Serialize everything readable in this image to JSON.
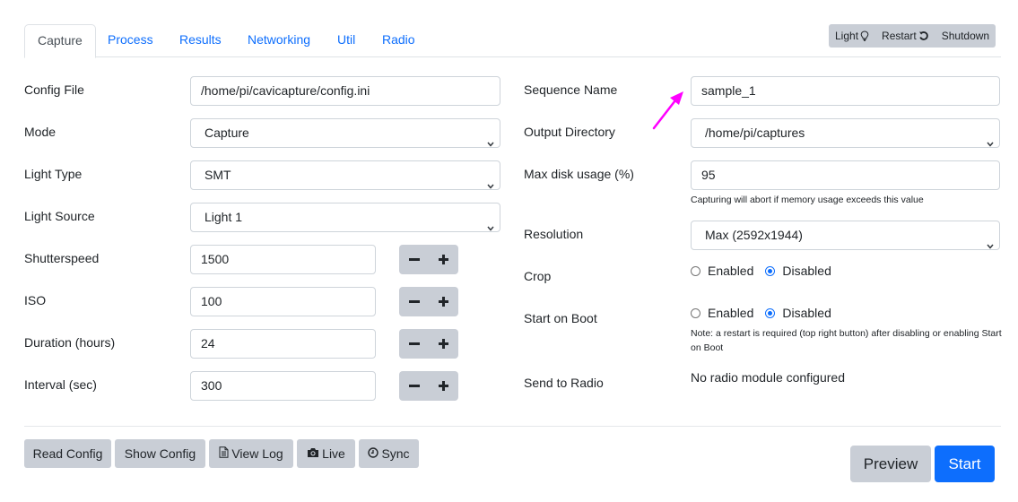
{
  "tabs": [
    {
      "label": "Capture",
      "active": true
    },
    {
      "label": "Process",
      "active": false
    },
    {
      "label": "Results",
      "active": false
    },
    {
      "label": "Networking",
      "active": false
    },
    {
      "label": "Util",
      "active": false
    },
    {
      "label": "Radio",
      "active": false
    }
  ],
  "top_buttons": {
    "light": {
      "label": "Light",
      "icon": "lightbulb-icon"
    },
    "restart": {
      "label": "Restart",
      "icon": "restart-icon"
    },
    "shutdown": {
      "label": "Shutdown"
    }
  },
  "left_form": {
    "config_file": {
      "label": "Config File",
      "value": "/home/pi/cavicapture/config.ini"
    },
    "mode": {
      "label": "Mode",
      "value": "Capture"
    },
    "light_type": {
      "label": "Light Type",
      "value": "SMT"
    },
    "light_source": {
      "label": "Light Source",
      "value": "Light 1"
    },
    "shutterspeed": {
      "label": "Shutterspeed",
      "value": "1500"
    },
    "iso": {
      "label": "ISO",
      "value": "100"
    },
    "duration": {
      "label": "Duration (hours)",
      "value": "24"
    },
    "interval": {
      "label": "Interval (sec)",
      "value": "300"
    },
    "stepper": {
      "minus": "−",
      "plus": "+"
    }
  },
  "right_form": {
    "sequence_name": {
      "label": "Sequence Name",
      "value": "sample_1"
    },
    "output_directory": {
      "label": "Output Directory",
      "value": "/home/pi/captures"
    },
    "max_disk_usage": {
      "label": "Max disk usage (%)",
      "value": "95",
      "help": "Capturing will abort if memory usage exceeds this value"
    },
    "resolution": {
      "label": "Resolution",
      "value": "Max (2592x1944)"
    },
    "crop": {
      "label": "Crop",
      "options": [
        {
          "label": "Enabled",
          "checked": false
        },
        {
          "label": "Disabled",
          "checked": true
        }
      ]
    },
    "start_on_boot": {
      "label": "Start on Boot",
      "options": [
        {
          "label": "Enabled",
          "checked": false
        },
        {
          "label": "Disabled",
          "checked": true
        }
      ],
      "help": "Note: a restart is required (top right button) after disabling or enabling Start on Boot"
    },
    "send_to_radio": {
      "label": "Send to Radio",
      "value": "No radio module configured"
    }
  },
  "bottom_buttons": {
    "read_config": "Read Config",
    "show_config": "Show Config",
    "view_log": "View Log",
    "live": "Live",
    "sync": "Sync",
    "preview": "Preview",
    "start": "Start"
  },
  "colors": {
    "accent": "#0d6efd",
    "secondary_button": "#c9ced6",
    "annotation_arrow": "#ff00ff"
  }
}
